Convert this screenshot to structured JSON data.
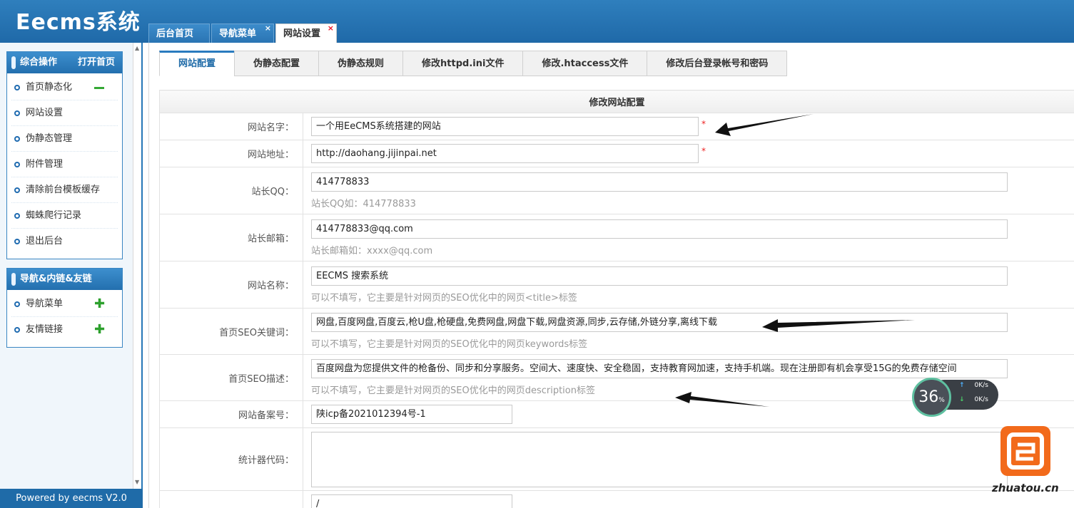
{
  "app": {
    "logo": "Eecms系统"
  },
  "top_tabs": [
    {
      "label": "后台首页",
      "close": ""
    },
    {
      "label": "导航菜单",
      "close": "×"
    },
    {
      "label": "网站设置",
      "close": "×"
    }
  ],
  "sidebar": {
    "panel1": {
      "title": "综合操作",
      "link": "打开首页",
      "items": [
        "首页静态化",
        "网站设置",
        "伪静态管理",
        "附件管理",
        "清除前台模板缓存",
        "蜘蛛爬行记录",
        "退出后台"
      ]
    },
    "panel2": {
      "title": "导航&内链&友链",
      "items": [
        "导航菜单",
        "友情链接"
      ],
      "plus": "✚"
    },
    "powered": "Powered by eecms V2.0"
  },
  "sub_tabs": [
    "网站配置",
    "伪静态配置",
    "伪静态规则",
    "修改httpd.ini文件",
    "修改.htaccess文件",
    "修改后台登录帐号和密码"
  ],
  "form": {
    "title": "修改网站配置",
    "required_mark": "*",
    "rows": {
      "site_name": {
        "label": "网站名字：",
        "value": "一个用EeCMS系统搭建的网站"
      },
      "site_url": {
        "label": "网站地址：",
        "value": "http://daohang.jijinpai.net"
      },
      "qq": {
        "label": "站长QQ：",
        "value": "414778833",
        "hint": "站长QQ如：414778833"
      },
      "email": {
        "label": "站长邮箱：",
        "value": "414778833@qq.com",
        "hint": "站长邮箱如：xxxx@qq.com"
      },
      "seo_title": {
        "label": "网站名称：",
        "value": "EECMS 搜索系统",
        "hint": "可以不填写，它主要是针对网页的SEO优化中的网页<title>标签"
      },
      "keywords": {
        "label": "首页SEO关键词：",
        "value": "网盘,百度网盘,百度云,枪U盘,枪硬盘,免费网盘,网盘下载,网盘资源,同步,云存储,外链分享,离线下载",
        "hint": "可以不填写，它主要是针对网页的SEO优化中的网页keywords标签"
      },
      "description": {
        "label": "首页SEO描述：",
        "value": "百度网盘为您提供文件的枪备份、同步和分享服务。空间大、速度快、安全稳固，支持教育网加速，支持手机端。现在注册即有机会享受15G的免费存储空间",
        "hint": "可以不填写，它主要是针对网页的SEO优化中的网页description标签"
      },
      "icp": {
        "label": "网站备案号：",
        "value": "陕icp备2021012394号-1"
      },
      "stats": {
        "label": "统计器代码：",
        "value": ""
      },
      "last": {
        "label": "",
        "value": "/"
      }
    }
  },
  "overlay": {
    "speed_percent": "36",
    "percent_sign": "%",
    "up_speed": "0",
    "down_speed": "0",
    "speed_unit": "K/s",
    "up_arrow": "↑",
    "down_arrow": "↓",
    "watermark": "zhuatou.cn"
  },
  "colors": {
    "header": "#2677b7",
    "accent": "#1f6ba8",
    "required": "#e22222",
    "add_icon": "#2da02d"
  }
}
